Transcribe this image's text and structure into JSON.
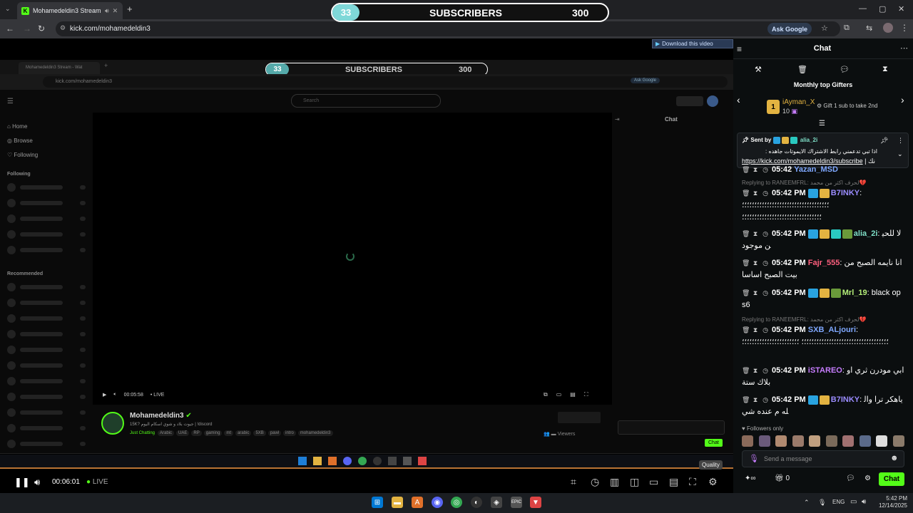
{
  "browser": {
    "tab_title": "Mohamedeldin3 Stream - V",
    "url": "kick.com/mohamedeldin3",
    "ask_google": "Ask Google"
  },
  "overlay": {
    "count": "33",
    "label": "SUBSCRIBERS",
    "goal": "300",
    "download_label": "Download this video"
  },
  "inner_stream": {
    "tab_title": "Mohamedeldin3 Stream - Wat",
    "url": "kick.com/mohamedeldin3",
    "search_placeholder": "Search",
    "ask_google": "Ask Google",
    "nav": {
      "home": "Home",
      "browse": "Browse",
      "following": "Following"
    },
    "section_following": "Following",
    "section_recommended": "Recommended",
    "chat_title": "Chat",
    "time": "00:05:58",
    "live": "LIVE",
    "channel_name": "Mohamedeldin3",
    "followers": "15K?",
    "stream_title": "جيوت بلاد و شوي اسكام اليوم | !discord",
    "category": "Just Chatting",
    "tags": [
      "Arabic",
      "UAE",
      "RP",
      "gaming",
      "mt",
      "arabic",
      "5XB",
      "pawl",
      "intro",
      "mohamedeldin3"
    ],
    "viewers_label": "Viewers",
    "chat_button": "Chat"
  },
  "player": {
    "time": "00:06:01",
    "live": "LIVE",
    "quality_tooltip": "Quality"
  },
  "chat": {
    "title": "Chat",
    "top_gifters_title": "Monthly top Gifters",
    "top_gifter_name": "iAyman_X",
    "top_gifter_count": "10",
    "gift_cta": "Gift 1 sub to take 2nd",
    "pinned": {
      "sent_by": "Sent by",
      "user": "alia_2i",
      "text": "اذا تبي تدعمني رابط الاشتراك الايموتات جاهده :",
      "link": "https://kick.com/mohamedeldin3/subscribe",
      "suffix": "| نك"
    },
    "partial_user": "Yazan_MSD",
    "messages": [
      {
        "reply": "Replying to RANEEMFRL: لحرف اكثر من محمد💔",
        "time": "05:42 PM",
        "user": "B7INKY",
        "color": "#9b8cff",
        "text": "؛؛؛؛؛؛؛؛؛؛؛؛؛؛؛؛؛؛؛؛؛؛؛؛؛؛؛؛؛؛؛؛؛؛؛ ؛؛؛؛؛؛؛؛؛؛؛؛؛؛؛؛؛؛؛؛؛؛؛؛؛؛؛؛؛؛؛؛"
      },
      {
        "reply": "",
        "time": "05:42 PM",
        "user": "alia_2i",
        "color": "#7fe0c8",
        "text": "لا للحين موجود"
      },
      {
        "reply": "",
        "time": "05:42 PM",
        "user": "Fajr_555",
        "color": "#ff5f7e",
        "text": "انا نايمه الصبح من بيت الصبح اساسا"
      },
      {
        "reply": "",
        "time": "05:42 PM",
        "user": "Mrl_19",
        "color": "#b6f07a",
        "text": "black ops6"
      },
      {
        "reply": "Replying to RANEEMFRL: لحرف اكثر من محمد💔",
        "time": "05:42 PM",
        "user": "SXB_ALjouri",
        "color": "#7fa8ff",
        "text": "؛؛؛؛؛؛؛؛؛؛؛؛؛؛؛؛؛؛؛؛؛؛؛؛؛؛؛؛؛؛؛؛؛؛؛ ؛؛؛؛؛؛؛؛؛؛؛؛؛؛؛؛؛؛؛؛؛؛؛"
      },
      {
        "reply": "",
        "time": "05:42 PM",
        "user": "iSTAREO",
        "color": "#c77dff",
        "text": "ابي مودرن ثري او بلاك ستة"
      },
      {
        "reply": "",
        "time": "05:42 PM",
        "user": "B7INKY",
        "color": "#9b8cff",
        "text": "ياهكر ترا والله م عنده شي"
      }
    ],
    "followers_only": "Followers only",
    "input_placeholder": "Send a message",
    "points": "0",
    "chat_button": "Chat"
  },
  "taskbar": {
    "lang": "ENG",
    "time": "5:42 PM",
    "date": "12/14/2025"
  }
}
